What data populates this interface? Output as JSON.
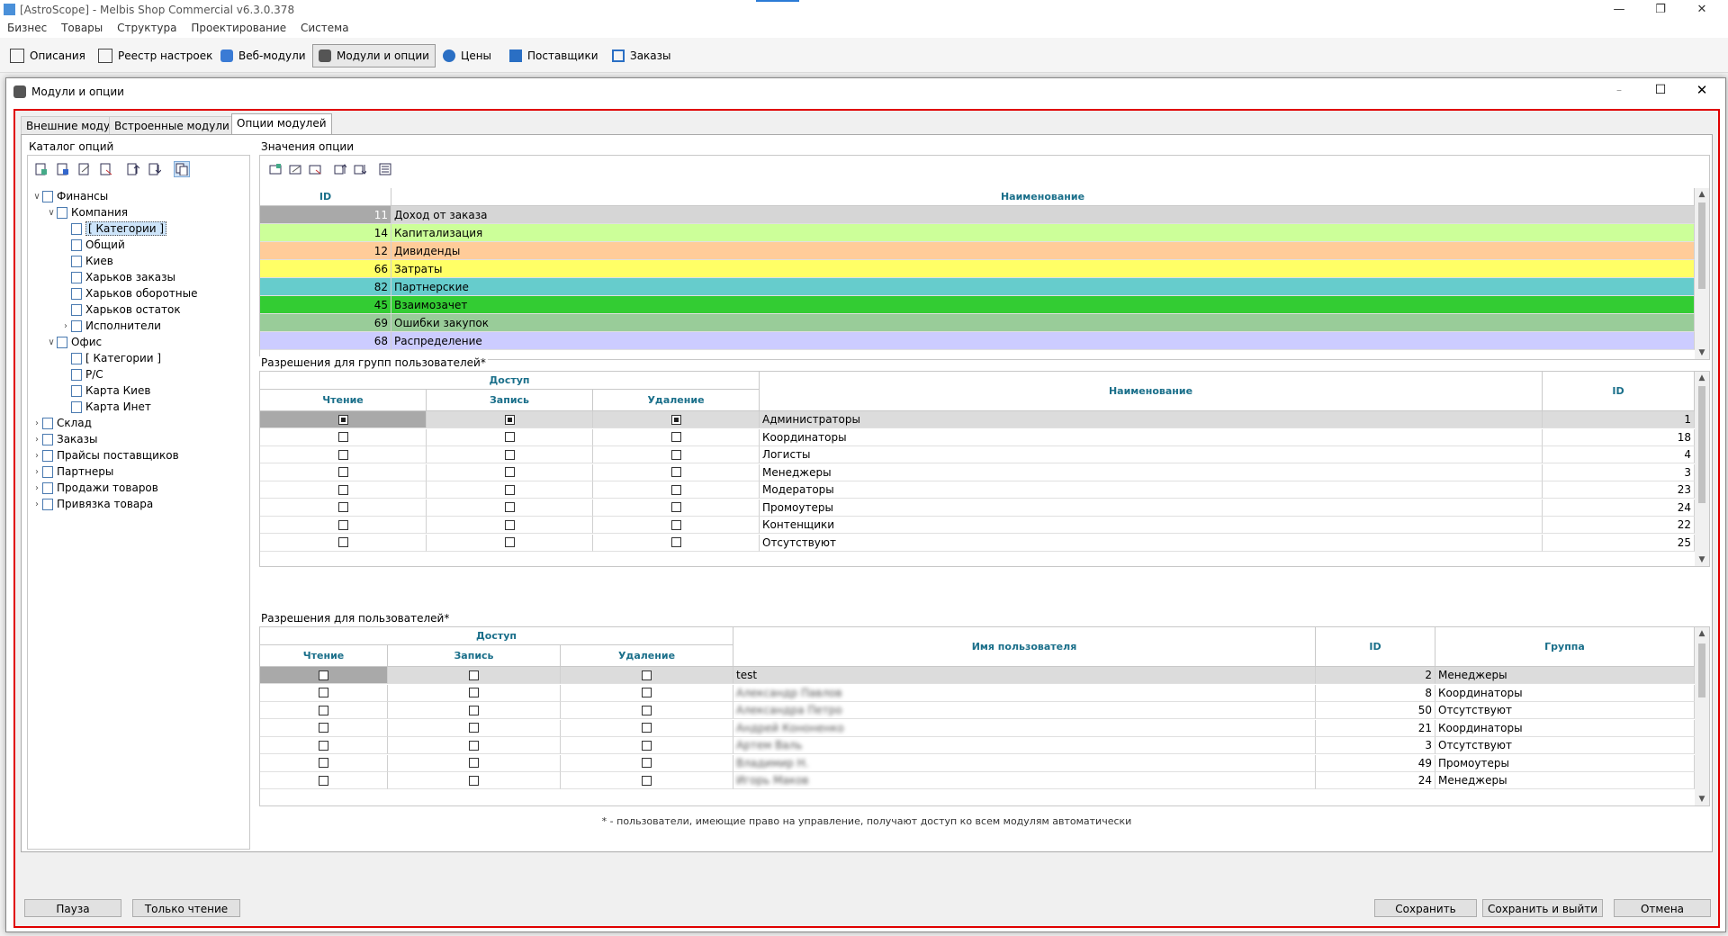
{
  "app": {
    "window_title": "[AstroScope] - Melbis Shop Commercial v6.3.0.378",
    "menu": [
      "Бизнес",
      "Товары",
      "Структура",
      "Проектирование",
      "Система"
    ],
    "toolbar": [
      "Описания",
      "Реестр настроек",
      "Веб-модули",
      "Модули и опции",
      "Цены",
      "Поставщики",
      "Заказы"
    ],
    "active_toolbar": "Модули и опции"
  },
  "dialog": {
    "title": "Модули и опции",
    "tabs": [
      "Внешние модули",
      "Встроенные модули",
      "Опции модулей"
    ],
    "active_tab": "Опции модулей"
  },
  "catalog": {
    "label": "Каталог опций",
    "tree": [
      {
        "label": "Финансы",
        "level": 0,
        "expanded": true
      },
      {
        "label": "Компания",
        "level": 1,
        "expanded": true
      },
      {
        "label": "[ Категории ]",
        "level": 2,
        "selected": true
      },
      {
        "label": "Общий",
        "level": 2
      },
      {
        "label": "Киев",
        "level": 2
      },
      {
        "label": "Харьков заказы",
        "level": 2
      },
      {
        "label": "Харьков оборотные",
        "level": 2
      },
      {
        "label": "Харьков остаток",
        "level": 2
      },
      {
        "label": "Исполнители",
        "level": 2,
        "collapsed": true
      },
      {
        "label": "Офис",
        "level": 1,
        "expanded": true
      },
      {
        "label": "[ Категории ]",
        "level": 2
      },
      {
        "label": "Р/С",
        "level": 2
      },
      {
        "label": "Карта Киев",
        "level": 2
      },
      {
        "label": "Карта Инет",
        "level": 2
      },
      {
        "label": "Склад",
        "level": 0,
        "collapsed": true
      },
      {
        "label": "Заказы",
        "level": 0,
        "collapsed": true
      },
      {
        "label": "Прайсы поставщиков",
        "level": 0,
        "collapsed": true
      },
      {
        "label": "Партнеры",
        "level": 0,
        "collapsed": true
      },
      {
        "label": "Продажи товаров",
        "level": 0,
        "collapsed": true
      },
      {
        "label": "Привязка товара",
        "level": 0,
        "collapsed": true
      }
    ]
  },
  "values": {
    "label": "Значения опции",
    "headers": {
      "id": "ID",
      "name": "Наименование"
    },
    "rows": [
      {
        "id": "11",
        "name": "Доход от заказа",
        "color": "#d6d6d6"
      },
      {
        "id": "14",
        "name": "Капитализация",
        "color": "#ccff99"
      },
      {
        "id": "12",
        "name": "Дивиденды",
        "color": "#ffcc99"
      },
      {
        "id": "66",
        "name": "Затраты",
        "color": "#ffff66"
      },
      {
        "id": "82",
        "name": "Партнерские",
        "color": "#66cccc"
      },
      {
        "id": "45",
        "name": "Взаимозачет",
        "color": "#33cc33"
      },
      {
        "id": "69",
        "name": "Ошибки закупок",
        "color": "#99cc99"
      },
      {
        "id": "68",
        "name": "Распределение",
        "color": "#ccccff"
      }
    ]
  },
  "group_perms": {
    "label": "Разрешения для групп пользователей*",
    "headers": {
      "access": "Доступ",
      "read": "Чтение",
      "write": "Запись",
      "delete": "Удаление",
      "name": "Наименование",
      "id": "ID"
    },
    "rows": [
      {
        "read": true,
        "write": true,
        "delete": true,
        "name": "Администраторы",
        "id": "1"
      },
      {
        "read": false,
        "write": false,
        "delete": false,
        "name": "Координаторы",
        "id": "18"
      },
      {
        "read": false,
        "write": false,
        "delete": false,
        "name": "Логисты",
        "id": "4"
      },
      {
        "read": false,
        "write": false,
        "delete": false,
        "name": "Менеджеры",
        "id": "3"
      },
      {
        "read": false,
        "write": false,
        "delete": false,
        "name": "Модераторы",
        "id": "23"
      },
      {
        "read": false,
        "write": false,
        "delete": false,
        "name": "Промоутеры",
        "id": "24"
      },
      {
        "read": false,
        "write": false,
        "delete": false,
        "name": "Контенщики",
        "id": "22"
      },
      {
        "read": false,
        "write": false,
        "delete": false,
        "name": "Отсутствуют",
        "id": "25"
      }
    ]
  },
  "user_perms": {
    "label": "Разрешения для пользователей*",
    "headers": {
      "access": "Доступ",
      "read": "Чтение",
      "write": "Запись",
      "delete": "Удаление",
      "username": "Имя пользователя",
      "id": "ID",
      "group": "Группа"
    },
    "rows": [
      {
        "username": "test",
        "blurred": false,
        "id": "2",
        "group": "Менеджеры"
      },
      {
        "username": "Александр Павлов",
        "blurred": true,
        "id": "8",
        "group": "Координаторы"
      },
      {
        "username": "Александра Петро",
        "blurred": true,
        "id": "50",
        "group": "Отсутствуют"
      },
      {
        "username": "Андрей Кононенко",
        "blurred": true,
        "id": "21",
        "group": "Координаторы"
      },
      {
        "username": "Артем Валь",
        "blurred": true,
        "id": "3",
        "group": "Отсутствуют"
      },
      {
        "username": "Владимир Н.",
        "blurred": true,
        "id": "49",
        "group": "Промоутеры"
      },
      {
        "username": "Игорь Маков",
        "blurred": true,
        "id": "24",
        "group": "Менеджеры"
      }
    ]
  },
  "footnote": "* - пользователи, имеющие право на управление, получают доступ ко всем модулям автоматически",
  "buttons": {
    "pause": "Пауза",
    "readonly": "Только чтение",
    "save": "Сохранить",
    "save_exit": "Сохранить и выйти",
    "cancel": "Отмена"
  },
  "colors": {
    "frame": "#e00000",
    "header_text": "#1a6f8a"
  }
}
